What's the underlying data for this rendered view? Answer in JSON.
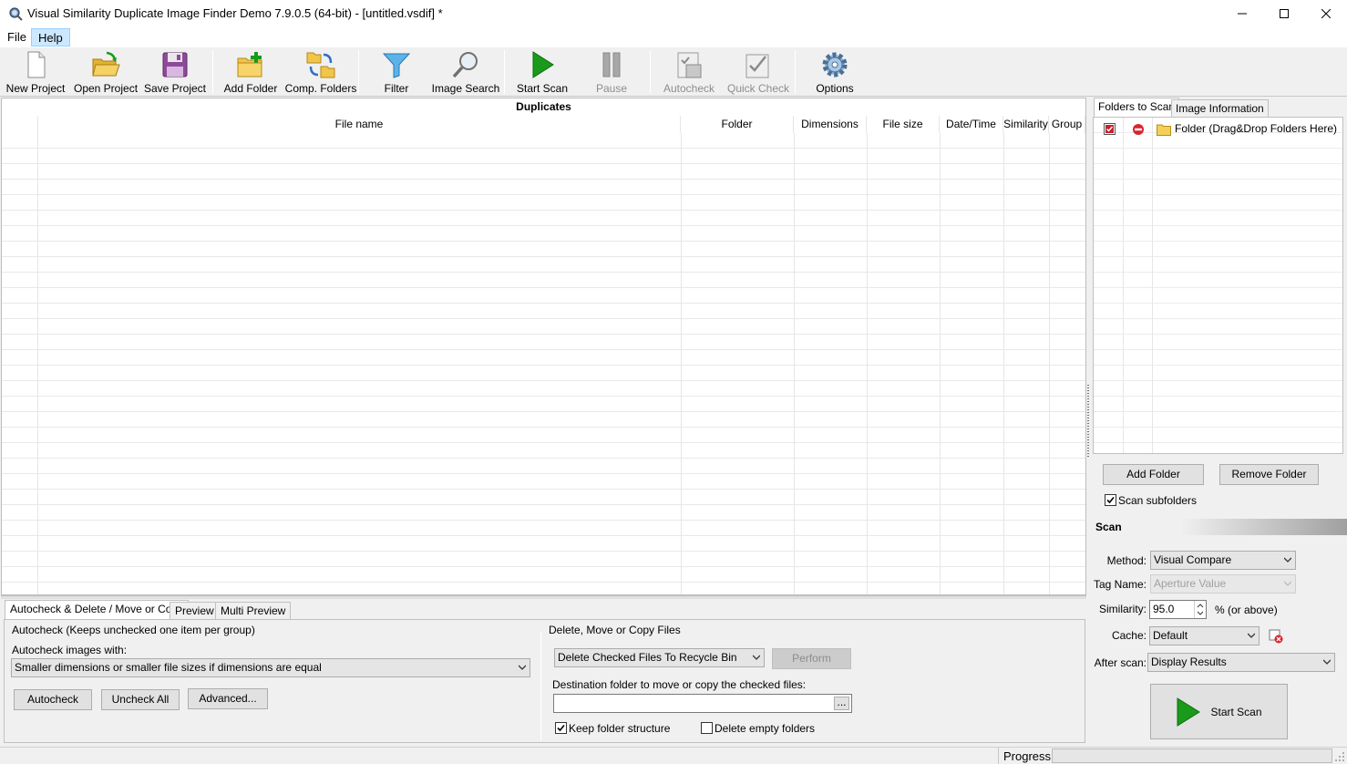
{
  "window": {
    "title": "Visual Similarity Duplicate Image Finder Demo 7.9.0.5 (64-bit) - [untitled.vsdif] *",
    "controls": [
      "minimize",
      "maximize",
      "close"
    ]
  },
  "menu": {
    "file": "File",
    "help": "Help"
  },
  "toolbar": {
    "new_project": "New Project",
    "open_project": "Open Project",
    "save_project": "Save Project",
    "add_folder": "Add Folder",
    "comp_folders": "Comp. Folders",
    "filter": "Filter",
    "image_search": "Image Search",
    "start_scan": "Start Scan",
    "pause": "Pause",
    "autocheck": "Autocheck",
    "quick_check": "Quick Check",
    "options": "Options"
  },
  "grid": {
    "caption": "Duplicates",
    "columns": [
      "File name",
      "Folder",
      "Dimensions",
      "File size",
      "Date/Time",
      "Similarity",
      "Group"
    ]
  },
  "bottom_tabs": [
    "Autocheck & Delete / Move or Copy",
    "Preview",
    "Multi Preview"
  ],
  "autocheck": {
    "group_title": "Autocheck (Keeps unchecked one item per group)",
    "images_with_label": "Autocheck images with:",
    "images_with_value": "Smaller dimensions or smaller file sizes if dimensions are equal",
    "autocheck_button": "Autocheck",
    "uncheck_all_button": "Uncheck All",
    "advanced_button": "Advanced..."
  },
  "delete_move": {
    "group_title": "Delete, Move or Copy Files",
    "action_value": "Delete Checked Files To Recycle Bin",
    "perform_button": "Perform",
    "destination_label": "Destination folder to move or copy the checked files:",
    "destination_value": "",
    "browse_button": "...",
    "keep_structure_label": "Keep folder structure",
    "keep_structure_checked": true,
    "delete_empty_label": "Delete empty folders",
    "delete_empty_checked": false
  },
  "right_tabs": [
    "Folders to Scan",
    "Image Information"
  ],
  "folders": {
    "placeholder_item": "Folder (Drag&Drop Folders Here)",
    "add_button": "Add Folder",
    "remove_button": "Remove Folder",
    "scan_subfolders_label": "Scan subfolders",
    "scan_subfolders_checked": true
  },
  "scan": {
    "header": "Scan",
    "method_label": "Method:",
    "method_value": "Visual Compare",
    "tag_name_label": "Tag Name:",
    "tag_name_value": "Aperture Value",
    "similarity_label": "Similarity:",
    "similarity_value": "95.0",
    "similarity_suffix": "% (or above)",
    "cache_label": "Cache:",
    "cache_value": "Default",
    "after_scan_label": "After scan:",
    "after_scan_value": "Display Results",
    "start_button": "Start Scan"
  },
  "status": {
    "progress_label": "Progress"
  },
  "colors": {
    "accent_green": "#1a9a1a",
    "menu_highlight": "#cce8ff",
    "error_red": "#c8202a"
  }
}
